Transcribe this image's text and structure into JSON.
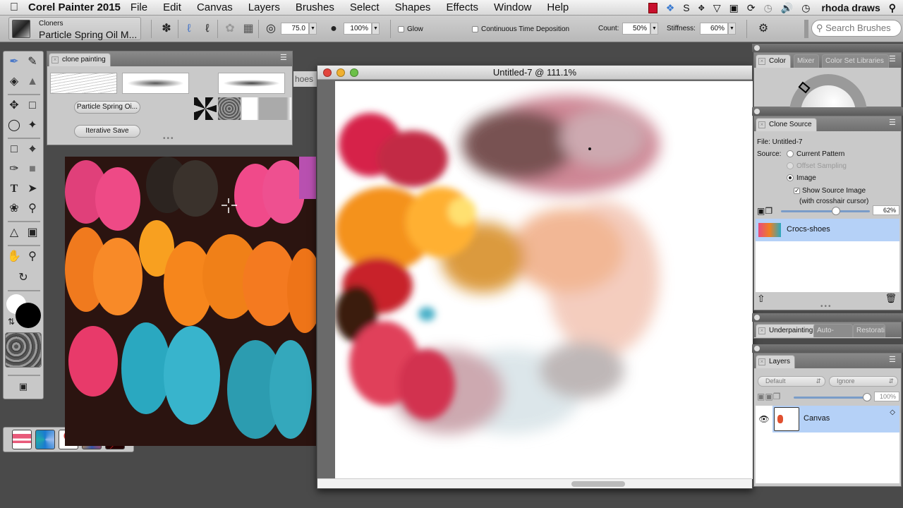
{
  "menubar": {
    "app_name": "Corel Painter 2015",
    "items": [
      "File",
      "Edit",
      "Canvas",
      "Layers",
      "Brushes",
      "Select",
      "Shapes",
      "Effects",
      "Window",
      "Help"
    ],
    "user": "rhoda draws",
    "status_icons": [
      "screen-record-icon",
      "dropbox-icon",
      "s-icon",
      "move-icon",
      "wifi-icon",
      "display-icon",
      "sync-icon",
      "time-machine-icon",
      "volume-icon",
      "clock-icon",
      "spotlight-icon"
    ]
  },
  "toolbar": {
    "brush_category": "Cloners",
    "brush_variant": "Particle Spring Oil M...",
    "size_value": "75.0",
    "opacity_value": "100%",
    "glow_label": "Glow",
    "glow_checked": false,
    "continuous_label": "Continuous Time Deposition",
    "continuous_checked": false,
    "count_label": "Count:",
    "count_value": "50%",
    "stiffness_label": "Stiffness:",
    "stiffness_value": "60%",
    "search_placeholder": "Search Brushes"
  },
  "clone_painting_panel": {
    "tab": "clone painting",
    "button_variant": "Particle Spring Oi...",
    "button_iterative": "Iterative Save"
  },
  "partial_tab": "hoes",
  "document": {
    "title": "Untitled-7 @ 111.1%"
  },
  "color_panel": {
    "tabs": [
      "Color",
      "Mixer",
      "Color Set Libraries"
    ]
  },
  "clone_source_panel": {
    "tab": "Clone Source",
    "file_label": "File: Untitled-7",
    "source_label": "Source:",
    "options": [
      {
        "label": "Current Pattern",
        "selected": false,
        "disabled": false
      },
      {
        "label": "Offset Sampling",
        "selected": false,
        "disabled": true
      },
      {
        "label": "Image",
        "selected": true,
        "disabled": false
      }
    ],
    "show_source_label": "Show Source Image",
    "show_source_sub": "(with crosshair cursor)",
    "show_source_checked": true,
    "opacity_value": "62%",
    "opacity_fraction": 0.62,
    "sources": [
      "Crocs-shoes"
    ]
  },
  "underpainting_panel": {
    "tabs": [
      "Underpainting",
      "Auto-",
      "Restorati"
    ]
  },
  "layers_panel": {
    "tab": "Layers",
    "composite_method": "Default",
    "composite_depth": "Ignore",
    "opacity_value": "100%",
    "opacity_fraction": 1.0,
    "layers": [
      {
        "name": "Canvas",
        "visible": true,
        "selected": true
      }
    ]
  },
  "colors": {
    "accent_selection": "#b5d1f7",
    "slider_blue": "#7a9cc8",
    "main_color": "#000000",
    "additional_color": "#ffffff"
  }
}
